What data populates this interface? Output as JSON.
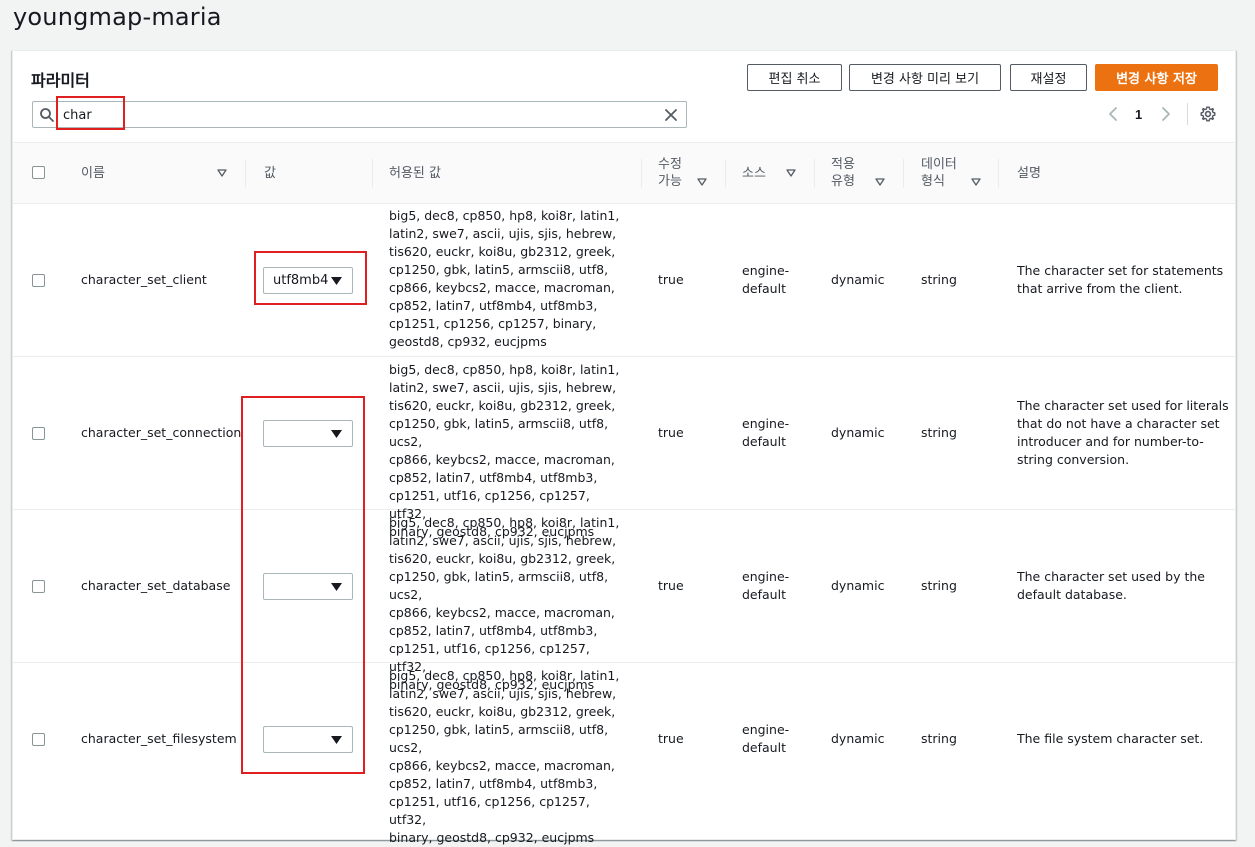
{
  "page": {
    "title": "youngmap-maria"
  },
  "panel": {
    "title": "파라미터",
    "buttons": {
      "cancel_edit": "편집 취소",
      "preview_changes": "변경 사항 미리 보기",
      "reset": "재설정",
      "save_changes": "변경 사항 저장"
    },
    "search": {
      "value": "char",
      "placeholder": ""
    },
    "pagination": {
      "current_page": "1"
    }
  },
  "colors": {
    "primary_button": "#ec7211",
    "highlight": "#e02020"
  },
  "table": {
    "columns": {
      "name": "이름",
      "value": "값",
      "allowed_values": "허용된 값",
      "modifiable_line1": "수정",
      "modifiable_line2": "가능",
      "source": "소스",
      "apply_type_line1": "적용",
      "apply_type_line2": "유형",
      "data_type_line1": "데이터",
      "data_type_line2": "형식",
      "description": "설명"
    },
    "rows": [
      {
        "name": "character_set_client",
        "value": "utf8mb4",
        "allowed": [
          "big5, dec8, cp850, hp8, koi8r, latin1,",
          "latin2, swe7, ascii, ujis, sjis, hebrew,",
          "tis620, euckr, koi8u, gb2312, greek,",
          "cp1250, gbk, latin5, armscii8, utf8,",
          "cp866, keybcs2, macce, macroman,",
          "cp852, latin7, utf8mb4, utf8mb3,",
          "cp1251, cp1256, cp1257, binary,",
          "geostd8, cp932, eucjpms"
        ],
        "modifiable": "true",
        "source_line1": "engine-",
        "source_line2": "default",
        "apply_type": "dynamic",
        "data_type": "string",
        "description": [
          "The character set for statements",
          "that arrive from the client."
        ]
      },
      {
        "name": "character_set_connection",
        "value": "",
        "allowed": [
          "big5, dec8, cp850, hp8, koi8r, latin1,",
          "latin2, swe7, ascii, ujis, sjis, hebrew,",
          "tis620, euckr, koi8u, gb2312, greek,",
          "cp1250, gbk, latin5, armscii8, utf8, ucs2,",
          "cp866, keybcs2, macce, macroman,",
          "cp852, latin7, utf8mb4, utf8mb3,",
          "cp1251, utf16, cp1256, cp1257, utf32,",
          "binary, geostd8, cp932, eucjpms"
        ],
        "modifiable": "true",
        "source_line1": "engine-",
        "source_line2": "default",
        "apply_type": "dynamic",
        "data_type": "string",
        "description": [
          "The character set used for literals",
          "that do not have a character set",
          "introducer and for number-to-",
          "string conversion."
        ]
      },
      {
        "name": "character_set_database",
        "value": "",
        "allowed": [
          "big5, dec8, cp850, hp8, koi8r, latin1,",
          "latin2, swe7, ascii, ujis, sjis, hebrew,",
          "tis620, euckr, koi8u, gb2312, greek,",
          "cp1250, gbk, latin5, armscii8, utf8, ucs2,",
          "cp866, keybcs2, macce, macroman,",
          "cp852, latin7, utf8mb4, utf8mb3,",
          "cp1251, utf16, cp1256, cp1257, utf32,",
          "binary, geostd8, cp932, eucjpms"
        ],
        "modifiable": "true",
        "source_line1": "engine-",
        "source_line2": "default",
        "apply_type": "dynamic",
        "data_type": "string",
        "description": [
          "The character set used by the",
          "default database."
        ]
      },
      {
        "name": "character_set_filesystem",
        "value": "",
        "allowed": [
          "big5, dec8, cp850, hp8, koi8r, latin1,",
          "latin2, swe7, ascii, ujis, sjis, hebrew,",
          "tis620, euckr, koi8u, gb2312, greek,",
          "cp1250, gbk, latin5, armscii8, utf8, ucs2,",
          "cp866, keybcs2, macce, macroman,",
          "cp852, latin7, utf8mb4, utf8mb3,",
          "cp1251, utf16, cp1256, cp1257, utf32,",
          "binary, geostd8, cp932, eucjpms"
        ],
        "modifiable": "true",
        "source_line1": "engine-",
        "source_line2": "default",
        "apply_type": "dynamic",
        "data_type": "string",
        "description": [
          "The file system character set."
        ]
      }
    ]
  }
}
